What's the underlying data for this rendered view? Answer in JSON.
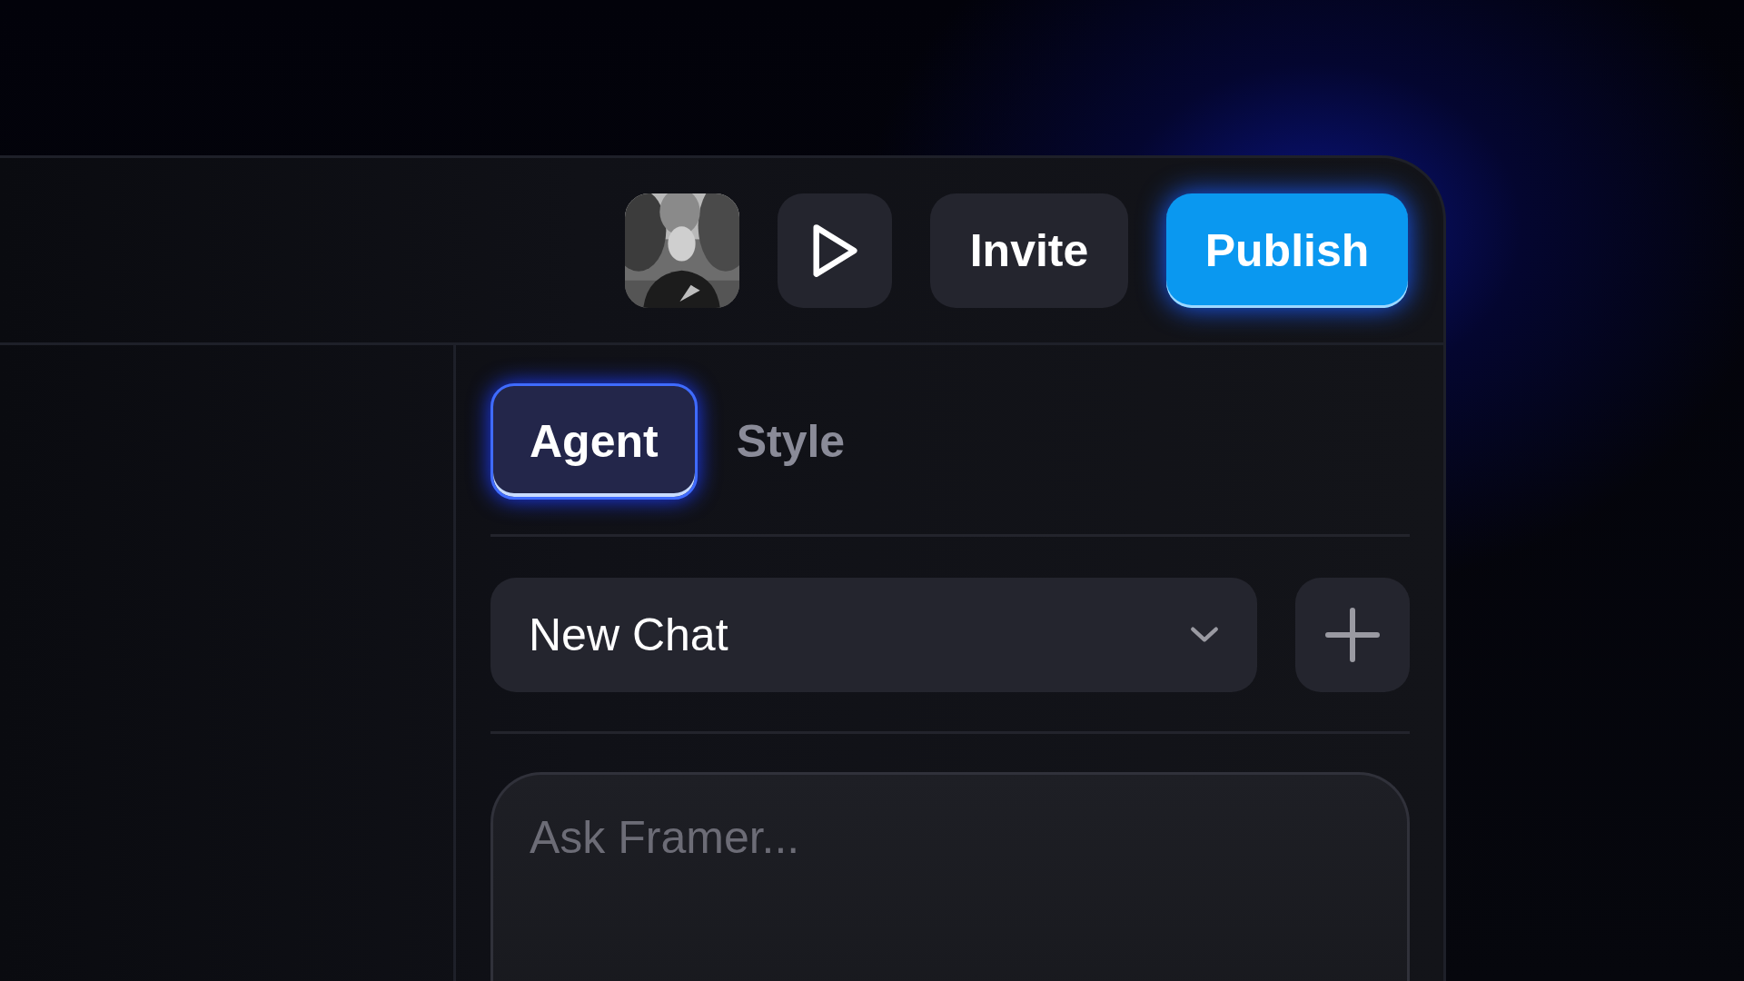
{
  "toolbar": {
    "invite_button": "Invite",
    "publish_button": "Publish"
  },
  "tabs": [
    {
      "label": "Agent",
      "selected": true
    },
    {
      "label": "Style",
      "selected": false
    }
  ],
  "chat_select": {
    "value": "New Chat"
  },
  "prompt": {
    "placeholder": "Ask Framer..."
  }
}
